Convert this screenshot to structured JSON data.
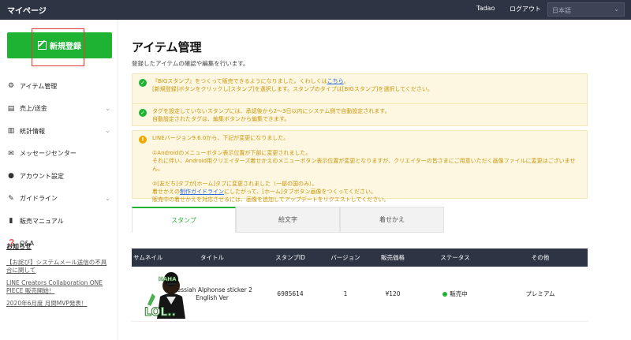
{
  "header": {
    "brand": "マイページ",
    "user": "Tadao",
    "logout": "ログアウト",
    "language": "日本語"
  },
  "sidebar": {
    "new_button": "新規登録",
    "items": [
      {
        "label": "アイテム管理",
        "icon": "gear-icon",
        "chevron": false
      },
      {
        "label": "売上/送金",
        "icon": "database-icon",
        "chevron": true
      },
      {
        "label": "統計情報",
        "icon": "chart-icon",
        "chevron": true
      },
      {
        "label": "メッセージセンター",
        "icon": "envelope-icon",
        "chevron": false
      },
      {
        "label": "アカウント設定",
        "icon": "user-icon",
        "chevron": false
      },
      {
        "label": "ガイドライン",
        "icon": "pencil-icon",
        "chevron": true
      },
      {
        "label": "販売マニュアル",
        "icon": "document-icon",
        "chevron": false
      },
      {
        "label": "Q&A",
        "icon": "question-icon",
        "chevron": false
      }
    ],
    "news": {
      "heading": "お知らせ",
      "items": [
        "【お詫び】システムメール送信の不具合に関して",
        "LINE Creators Collaboration ONE PIECE 販売開始！",
        "2020年6月度 月間MVP発表！"
      ]
    }
  },
  "main": {
    "title": "アイテム管理",
    "subtitle": "登録したアイテムの確認や編集を行います。",
    "notices": [
      {
        "type": "success",
        "line1_pre": "『BIGスタンプ』をつくって販売できるようになりました。くわしくは",
        "line1_link": "こちら",
        "line1_post": "。",
        "line2": "[新規登録]ボタンをクリックし[スタンプ]を選択します。スタンプのタイプは[BIGスタンプ]を選択してください。"
      },
      {
        "type": "success",
        "line1": "タグを設定していないスタンプには、承認後から2〜3日以内にシステム側で自動設定されます。",
        "line2": "自動設定されたタグは、編集ボタンから編集できます。"
      },
      {
        "type": "info",
        "line1": "LINEバージョン9.6.0から、下記が変更になりました。",
        "p1_line1": "①Androidのメニューボタン表示位置が下部に変更されました。",
        "p1_line2": "それに伴い、Android用クリエイターズ着せかえのメニューボタン表示位置が変更となりますが、クリエイターの皆さまにご用意いただく画像ファイルに変更はございません。",
        "p2_line1": "②[友だち]タブが[ホーム]タブに変更されました（一部の国のみ）。",
        "p2_line2_pre": "着せかえの",
        "p2_line2_link": "制作ガイドライン",
        "p2_line2_post": "にしたがって、[ホーム]タブボタン画像をつくってください。",
        "p2_line3": "販売中の着せかえを対応させるには、画像を追加してアップデートをリクエストしてください。"
      }
    ],
    "tabs": [
      "スタンプ",
      "絵文字",
      "着せかえ"
    ],
    "table": {
      "headers": [
        "サムネイル",
        "タイトル",
        "スタンプID",
        "バージョン",
        "販売価格",
        "ステータス",
        "その他"
      ],
      "rows": [
        {
          "title": "Messiah Alphonse sticker 2 English Ver",
          "sticker_id": "6985614",
          "version": "1",
          "price": "¥120",
          "status": "販売中",
          "other": "プレミアム",
          "sticker_text_top": "HAHA",
          "sticker_text_bottom": "LOL.."
        }
      ]
    }
  },
  "colors": {
    "topbar": "#2d3444",
    "brand_green": "#1fb333",
    "notice_bg": "#fdf7e1",
    "notice_text": "#c8960a",
    "link": "#2a6bd6",
    "highlight_box": "#e53935"
  }
}
